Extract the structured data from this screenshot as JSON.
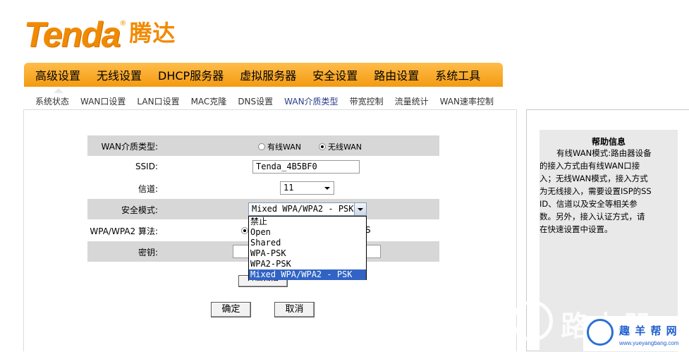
{
  "logo": {
    "latin": "Tenda",
    "registered": "®",
    "cjk": "腾达"
  },
  "main_nav": [
    "高级设置",
    "无线设置",
    "DHCP服务器",
    "虚拟服务器",
    "安全设置",
    "路由设置",
    "系统工具"
  ],
  "sub_nav": [
    "系统状态",
    "WAN口设置",
    "LAN口设置",
    "MAC克隆",
    "DNS设置",
    "WAN介质类型",
    "带宽控制",
    "流量统计",
    "WAN速率控制"
  ],
  "form": {
    "wan_type_label": "WAN介质类型:",
    "wan_wired": "有线WAN",
    "wan_wireless": "无线WAN",
    "ssid_label": "SSID:",
    "ssid_value": "Tenda_4B5BF0",
    "channel_label": "信道:",
    "channel_value": "11",
    "security_label": "安全模式:",
    "security_value": "Mixed WPA/WPA2 - PSK",
    "algo_label": "WPA/WPA2 算法:",
    "algo_partial": "S",
    "key_label": "密钥:",
    "scan_button_partial": "开启扫描",
    "ok_button": "确定",
    "cancel_button": "取消"
  },
  "dropdown_options": [
    "禁止",
    "Open",
    "Shared",
    "WPA-PSK",
    "WPA2-PSK",
    "Mixed WPA/WPA2 - PSK"
  ],
  "dropdown_selected_index": 5,
  "help": {
    "title": "帮助信息",
    "text": "有线WAN模式:路由器设备的接入方式由有线WAN口接入；无线WAN模式，接入方式为无线接入，需要设置ISP的SSID、信道以及安全等相关参数。另外，接入认证方式，请在快速设置中设置。"
  },
  "watermark": {
    "big": "路由器",
    "cn": "趣 羊 帮 网",
    "url": "www.yueyangbang.com"
  }
}
